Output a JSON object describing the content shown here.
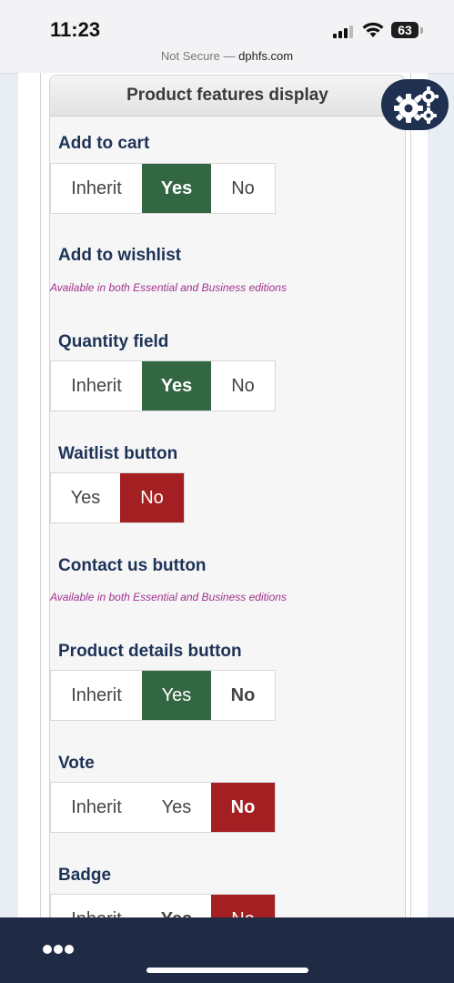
{
  "status": {
    "time": "11:23",
    "battery": "63",
    "url_prefix": "Not Secure — ",
    "url_domain": "dphfs.com"
  },
  "panel": {
    "title": "Product features display"
  },
  "features": [
    {
      "label": "Add to cart",
      "options": [
        "Inherit",
        "Yes",
        "No"
      ],
      "selected": "Yes"
    },
    {
      "label": "Add to wishlist",
      "note": "Available in both Essential and Business editions"
    },
    {
      "label": "Quantity field",
      "options": [
        "Inherit",
        "Yes",
        "No"
      ],
      "selected": "Yes"
    },
    {
      "label": "Waitlist button",
      "options": [
        "Yes",
        "No"
      ],
      "selected": "No"
    },
    {
      "label": "Contact us button",
      "note": "Available in both Essential and Business editions"
    },
    {
      "label": "Product details button",
      "options": [
        "Inherit",
        "Yes",
        "No"
      ],
      "selected": "Yes"
    },
    {
      "label": "Vote",
      "options": [
        "Inherit",
        "Yes",
        "No"
      ],
      "selected": "No"
    },
    {
      "label": "Badge",
      "options": [
        "Inherit",
        "Yes",
        "No"
      ],
      "selected": "No"
    }
  ],
  "colors": {
    "yes_selected": "#336642",
    "no_selected": "#a31f22",
    "label": "#1d3357",
    "note": "#a2318f",
    "bottom_bar": "#1f2b45"
  },
  "icons": {
    "settings": "gears-icon",
    "menu": "more-dots-icon"
  }
}
